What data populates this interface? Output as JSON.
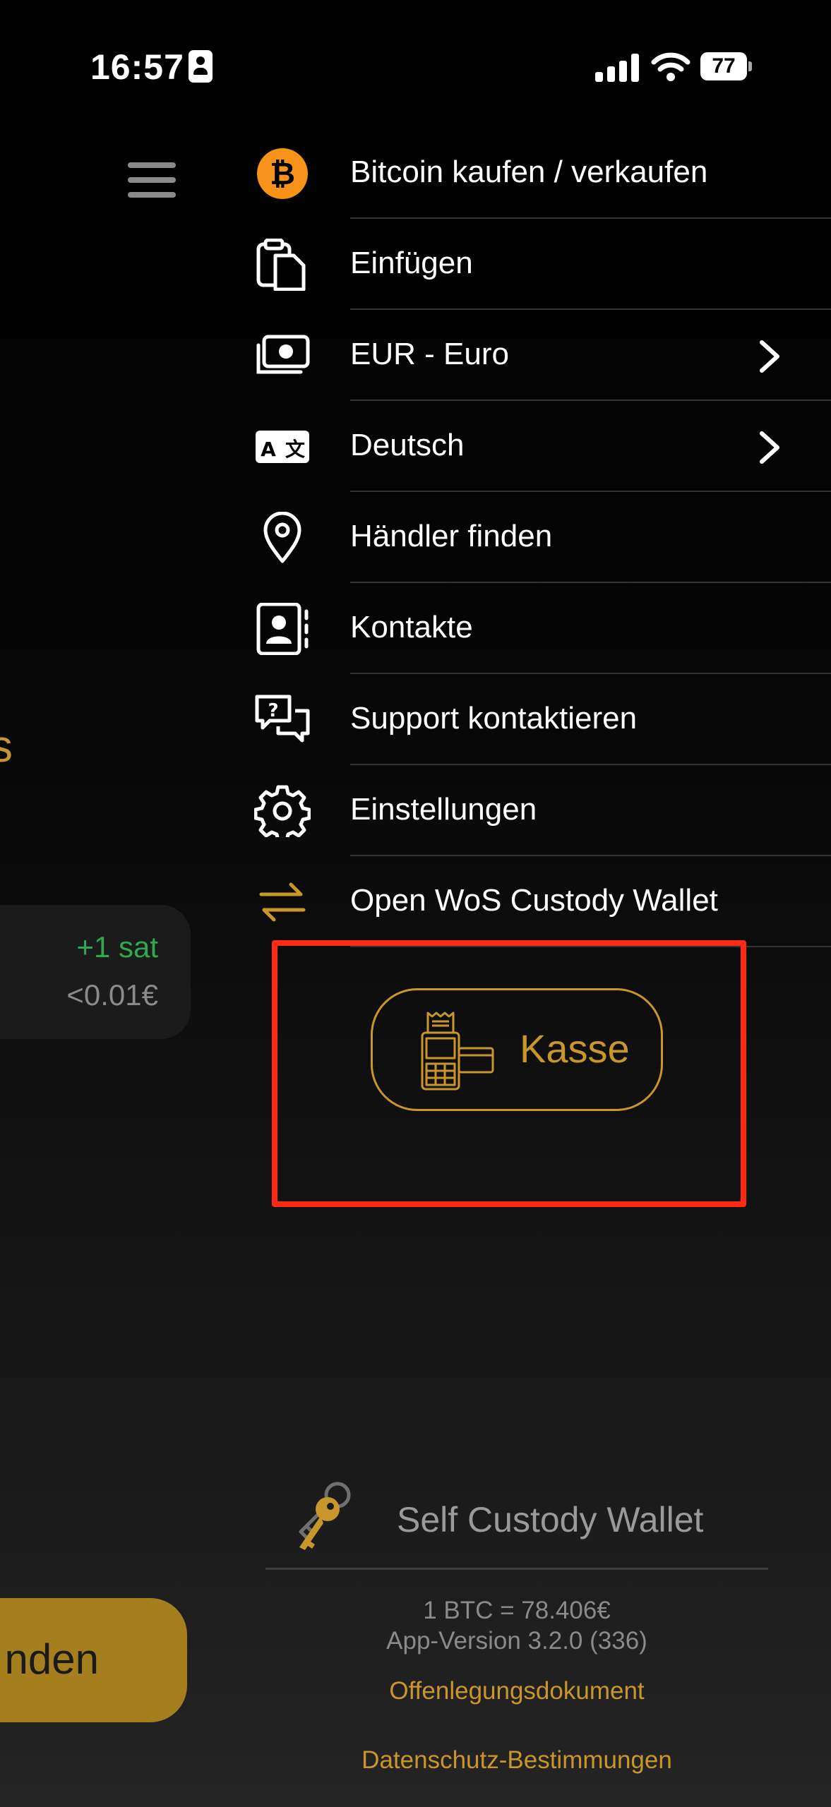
{
  "status_bar": {
    "time": "16:57",
    "battery": "77"
  },
  "background": {
    "partial_unit": "s",
    "transaction": {
      "amount_sat": "+1 sat",
      "amount_eur": "<0.01€"
    },
    "button_label": "nden"
  },
  "menu": {
    "items": [
      {
        "label": "Bitcoin kaufen / verkaufen",
        "icon": "bitcoin-icon"
      },
      {
        "label": "Einfügen",
        "icon": "clipboard-icon"
      },
      {
        "label": "EUR - Euro",
        "icon": "banknote-icon",
        "chevron": true
      },
      {
        "label": "Deutsch",
        "icon": "translate-icon",
        "chevron": true
      },
      {
        "label": "Händler finden",
        "icon": "map-pin-icon"
      },
      {
        "label": "Kontakte",
        "icon": "contacts-icon"
      },
      {
        "label": "Support kontaktieren",
        "icon": "support-chat-icon"
      },
      {
        "label": "Einstellungen",
        "icon": "gear-icon"
      },
      {
        "label": "Open WoS Custody Wallet",
        "icon": "swap-arrows-icon"
      }
    ],
    "kasse_label": "Kasse"
  },
  "footer": {
    "self_custody_label": "Self Custody Wallet",
    "btc_rate": "1 BTC = 78.406€",
    "app_version": "App-Version 3.2.0 (336)",
    "disclosure_link": "Offenlegungsdokument",
    "privacy_link": "Datenschutz-Bestimmungen"
  },
  "colors": {
    "accent_gold": "#c9962b",
    "positive_green": "#2fa84f",
    "highlight_red": "#ff2a14",
    "bitcoin_orange": "#f7931a"
  }
}
